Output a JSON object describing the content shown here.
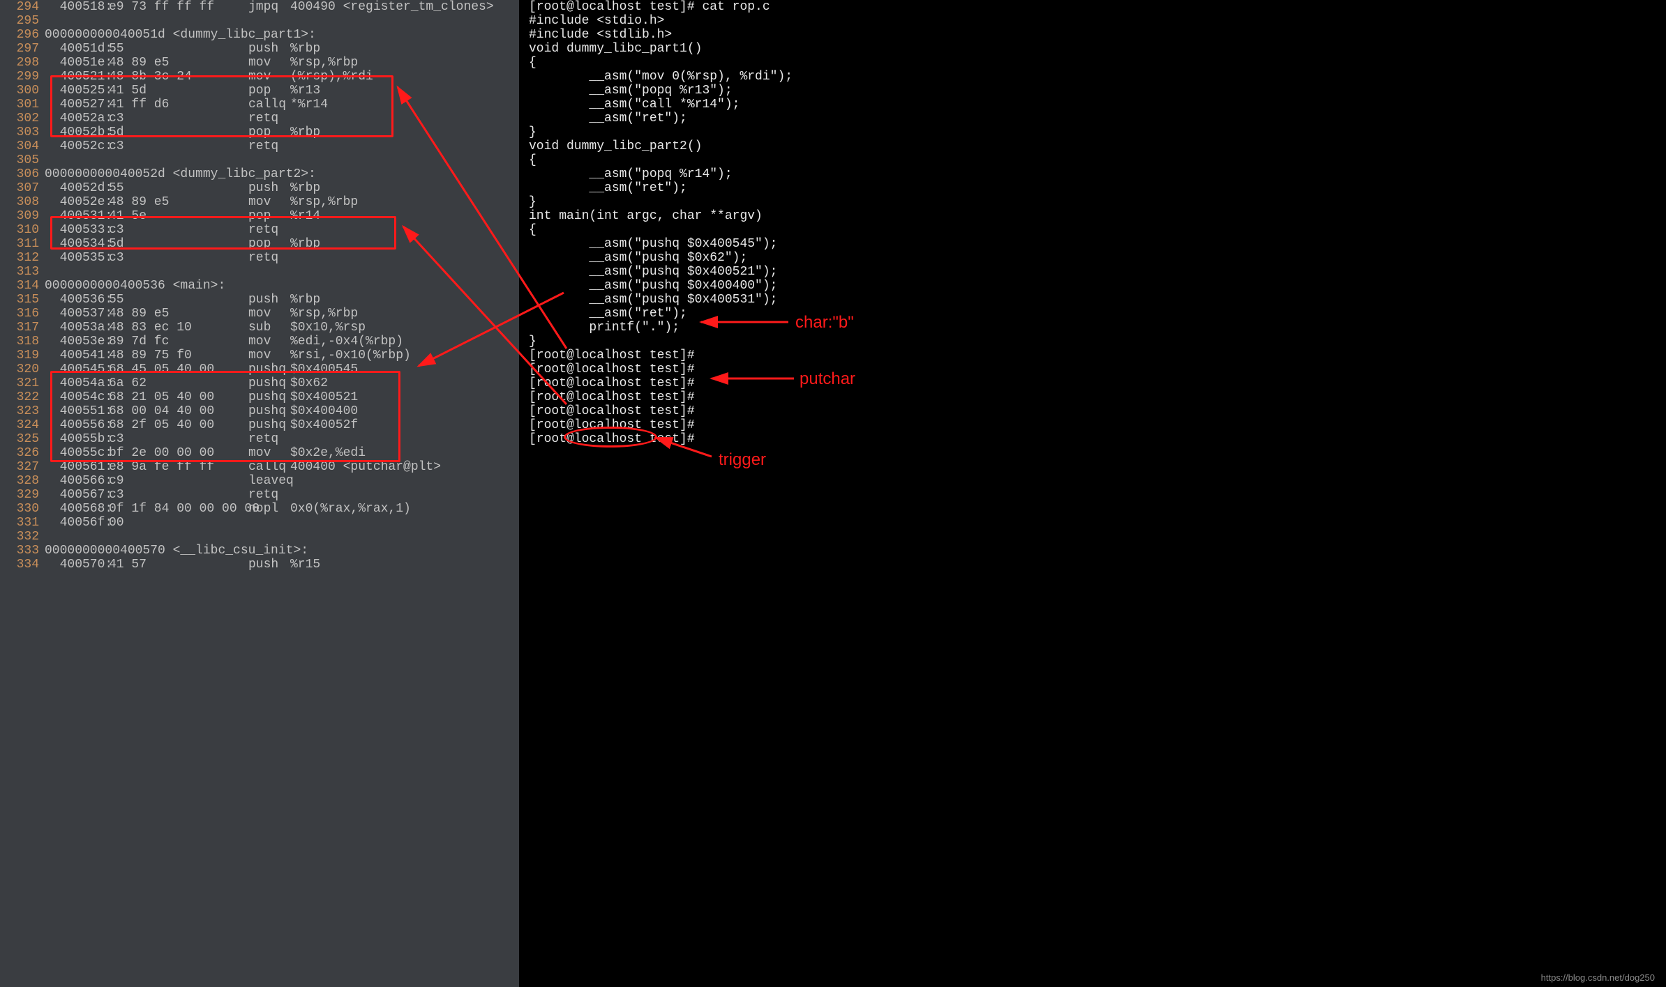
{
  "left": {
    "rows": [
      {
        "ln": "294",
        "addr": "400518:",
        "bytes": "e9 73 ff ff ff",
        "mnem": "jmpq",
        "ops": "400490 <register_tm_clones>"
      },
      {
        "ln": "295",
        "addr": "",
        "bytes": "",
        "mnem": "",
        "ops": ""
      },
      {
        "ln": "296",
        "label": "000000000040051d <dummy_libc_part1>:"
      },
      {
        "ln": "297",
        "addr": "40051d:",
        "bytes": "55",
        "mnem": "push",
        "ops": "%rbp"
      },
      {
        "ln": "298",
        "addr": "40051e:",
        "bytes": "48 89 e5",
        "mnem": "mov",
        "ops": "%rsp,%rbp"
      },
      {
        "ln": "299",
        "addr": "400521:",
        "bytes": "48 8b 3c 24",
        "mnem": "mov",
        "ops": "(%rsp),%rdi"
      },
      {
        "ln": "300",
        "addr": "400525:",
        "bytes": "41 5d",
        "mnem": "pop",
        "ops": "%r13"
      },
      {
        "ln": "301",
        "addr": "400527:",
        "bytes": "41 ff d6",
        "mnem": "callq",
        "ops": "*%r14"
      },
      {
        "ln": "302",
        "addr": "40052a:",
        "bytes": "c3",
        "mnem": "retq",
        "ops": ""
      },
      {
        "ln": "303",
        "addr": "40052b:",
        "bytes": "5d",
        "mnem": "pop",
        "ops": "%rbp"
      },
      {
        "ln": "304",
        "addr": "40052c:",
        "bytes": "c3",
        "mnem": "retq",
        "ops": ""
      },
      {
        "ln": "305",
        "addr": "",
        "bytes": "",
        "mnem": "",
        "ops": ""
      },
      {
        "ln": "306",
        "label": "000000000040052d <dummy_libc_part2>:"
      },
      {
        "ln": "307",
        "addr": "40052d:",
        "bytes": "55",
        "mnem": "push",
        "ops": "%rbp"
      },
      {
        "ln": "308",
        "addr": "40052e:",
        "bytes": "48 89 e5",
        "mnem": "mov",
        "ops": "%rsp,%rbp"
      },
      {
        "ln": "309",
        "addr": "400531:",
        "bytes": "41 5e",
        "mnem": "pop",
        "ops": "%r14"
      },
      {
        "ln": "310",
        "addr": "400533:",
        "bytes": "c3",
        "mnem": "retq",
        "ops": ""
      },
      {
        "ln": "311",
        "addr": "400534:",
        "bytes": "5d",
        "mnem": "pop",
        "ops": "%rbp"
      },
      {
        "ln": "312",
        "addr": "400535:",
        "bytes": "c3",
        "mnem": "retq",
        "ops": ""
      },
      {
        "ln": "313",
        "addr": "",
        "bytes": "",
        "mnem": "",
        "ops": ""
      },
      {
        "ln": "314",
        "label": "0000000000400536 <main>:"
      },
      {
        "ln": "315",
        "addr": "400536:",
        "bytes": "55",
        "mnem": "push",
        "ops": "%rbp"
      },
      {
        "ln": "316",
        "addr": "400537:",
        "bytes": "48 89 e5",
        "mnem": "mov",
        "ops": "%rsp,%rbp"
      },
      {
        "ln": "317",
        "addr": "40053a:",
        "bytes": "48 83 ec 10",
        "mnem": "sub",
        "ops": "$0x10,%rsp"
      },
      {
        "ln": "318",
        "addr": "40053e:",
        "bytes": "89 7d fc",
        "mnem": "mov",
        "ops": "%edi,-0x4(%rbp)"
      },
      {
        "ln": "319",
        "addr": "400541:",
        "bytes": "48 89 75 f0",
        "mnem": "mov",
        "ops": "%rsi,-0x10(%rbp)"
      },
      {
        "ln": "320",
        "addr": "400545:",
        "bytes": "68 45 05 40 00",
        "mnem": "pushq",
        "ops": "$0x400545"
      },
      {
        "ln": "321",
        "addr": "40054a:",
        "bytes": "6a 62",
        "mnem": "pushq",
        "ops": "$0x62"
      },
      {
        "ln": "322",
        "addr": "40054c:",
        "bytes": "68 21 05 40 00",
        "mnem": "pushq",
        "ops": "$0x400521"
      },
      {
        "ln": "323",
        "addr": "400551:",
        "bytes": "68 00 04 40 00",
        "mnem": "pushq",
        "ops": "$0x400400"
      },
      {
        "ln": "324",
        "addr": "400556:",
        "bytes": "68 2f 05 40 00",
        "mnem": "pushq",
        "ops": "$0x40052f"
      },
      {
        "ln": "325",
        "addr": "40055b:",
        "bytes": "c3",
        "mnem": "retq",
        "ops": ""
      },
      {
        "ln": "326",
        "addr": "40055c:",
        "bytes": "bf 2e 00 00 00",
        "mnem": "mov",
        "ops": "$0x2e,%edi"
      },
      {
        "ln": "327",
        "addr": "400561:",
        "bytes": "e8 9a fe ff ff",
        "mnem": "callq",
        "ops": "400400 <putchar@plt>"
      },
      {
        "ln": "328",
        "addr": "400566:",
        "bytes": "c9",
        "mnem": "leaveq",
        "ops": ""
      },
      {
        "ln": "329",
        "addr": "400567:",
        "bytes": "c3",
        "mnem": "retq",
        "ops": ""
      },
      {
        "ln": "330",
        "addr": "400568:",
        "bytes": "0f 1f 84 00 00 00 00",
        "mnem": "nopl",
        "ops": "0x0(%rax,%rax,1)"
      },
      {
        "ln": "331",
        "addr": "40056f:",
        "bytes": "00",
        "mnem": "",
        "ops": ""
      },
      {
        "ln": "332",
        "addr": "",
        "bytes": "",
        "mnem": "",
        "ops": ""
      },
      {
        "ln": "333",
        "label": "0000000000400570 <__libc_csu_init>:"
      },
      {
        "ln": "334",
        "addr": "400570:",
        "bytes": "41 57",
        "mnem": "push",
        "ops": "%r15"
      }
    ]
  },
  "right": {
    "lines": [
      "[root@localhost test]# cat rop.c",
      "#include <stdio.h>",
      "#include <stdlib.h>",
      "",
      "void dummy_libc_part1()",
      "{",
      "        __asm(\"mov 0(%rsp), %rdi\");",
      "        __asm(\"popq %r13\");",
      "        __asm(\"call *%r14\");",
      "        __asm(\"ret\");",
      "}",
      "",
      "void dummy_libc_part2()",
      "{",
      "        __asm(\"popq %r14\");",
      "        __asm(\"ret\");",
      "}",
      "",
      "int main(int argc, char **argv)",
      "{",
      "        __asm(\"pushq $0x400545\");",
      "",
      "        __asm(\"pushq $0x62\");",
      "",
      "        __asm(\"pushq $0x400521\");",
      "",
      "        __asm(\"pushq $0x400400\");",
      "",
      "        __asm(\"pushq $0x400531\");",
      "",
      "        __asm(\"ret\");",
      "",
      "        printf(\".\");",
      "}",
      "[root@localhost test]#",
      "[root@localhost test]#",
      "[root@localhost test]#",
      "[root@localhost test]#",
      "[root@localhost test]#",
      "[root@localhost test]#",
      "[root@localhost test]#"
    ]
  },
  "annotations": {
    "label_char": "char:\"b\"",
    "label_putchar": "putchar",
    "label_trigger": "trigger"
  },
  "watermark": "https://blog.csdn.net/dog250"
}
